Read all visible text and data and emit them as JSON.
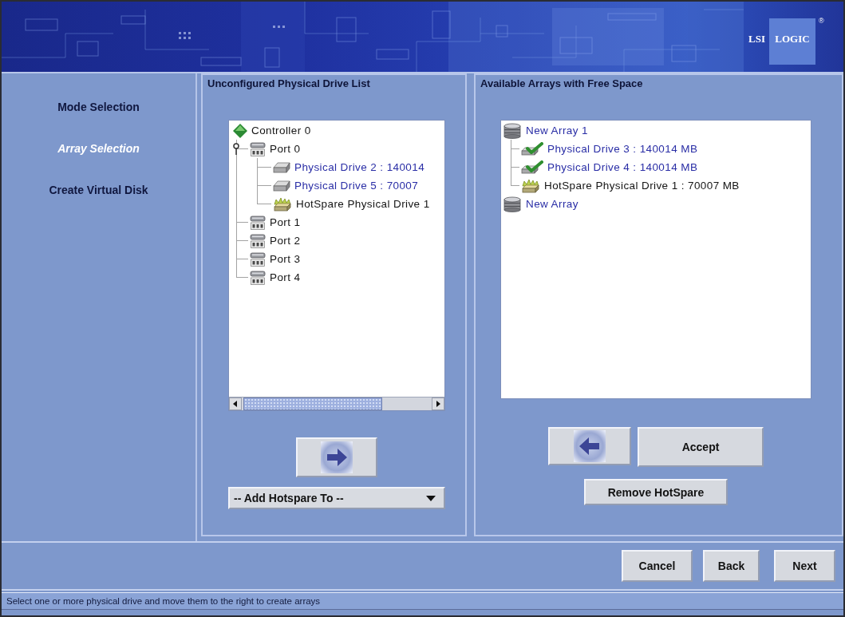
{
  "header": {
    "logo": {
      "first_word": "LSI",
      "second_word": "LOGIC",
      "mark": "®"
    }
  },
  "steps": [
    {
      "label": "Mode Selection",
      "selected": false
    },
    {
      "label": "Array Selection",
      "selected": true
    },
    {
      "label": "Create Virtual Disk",
      "selected": false
    }
  ],
  "unconfigured_panel": {
    "title": "Unconfigured Physical Drive List",
    "tree": [
      {
        "kind": "controller",
        "label": "Controller 0",
        "children": [
          {
            "kind": "port",
            "label": "Port 0",
            "children": [
              {
                "kind": "drive",
                "label": "Physical Drive 2 : 140014"
              },
              {
                "kind": "drive",
                "label": "Physical Drive 5 : 70007"
              },
              {
                "kind": "hotspare",
                "label": "HotSpare Physical Drive 1"
              }
            ]
          },
          {
            "kind": "port",
            "label": "Port 1"
          },
          {
            "kind": "port",
            "label": "Port 2"
          },
          {
            "kind": "port",
            "label": "Port 3"
          },
          {
            "kind": "port",
            "label": "Port 4"
          }
        ]
      }
    ],
    "hotspare_dropdown": {
      "value": "-- Add Hotspare To --"
    }
  },
  "arrays_panel": {
    "title": "Available Arrays with Free Space",
    "tree": [
      {
        "kind": "array",
        "label": "New Array 1",
        "children": [
          {
            "kind": "member",
            "label": "Physical Drive 3 : 140014 MB"
          },
          {
            "kind": "member",
            "label": "Physical Drive 4 : 140014 MB"
          },
          {
            "kind": "hotspare",
            "label": "HotSpare Physical Drive 1 : 70007 MB"
          }
        ]
      },
      {
        "kind": "array",
        "label": "New Array"
      }
    ],
    "accept_button": "Accept",
    "remove_hotspare_button": "Remove HotSpare"
  },
  "footer": {
    "cancel_button": "Cancel",
    "back_button": "Back",
    "next_button": "Next"
  },
  "status_bar": "Select one or more physical drive and move them to the right to create arrays"
}
